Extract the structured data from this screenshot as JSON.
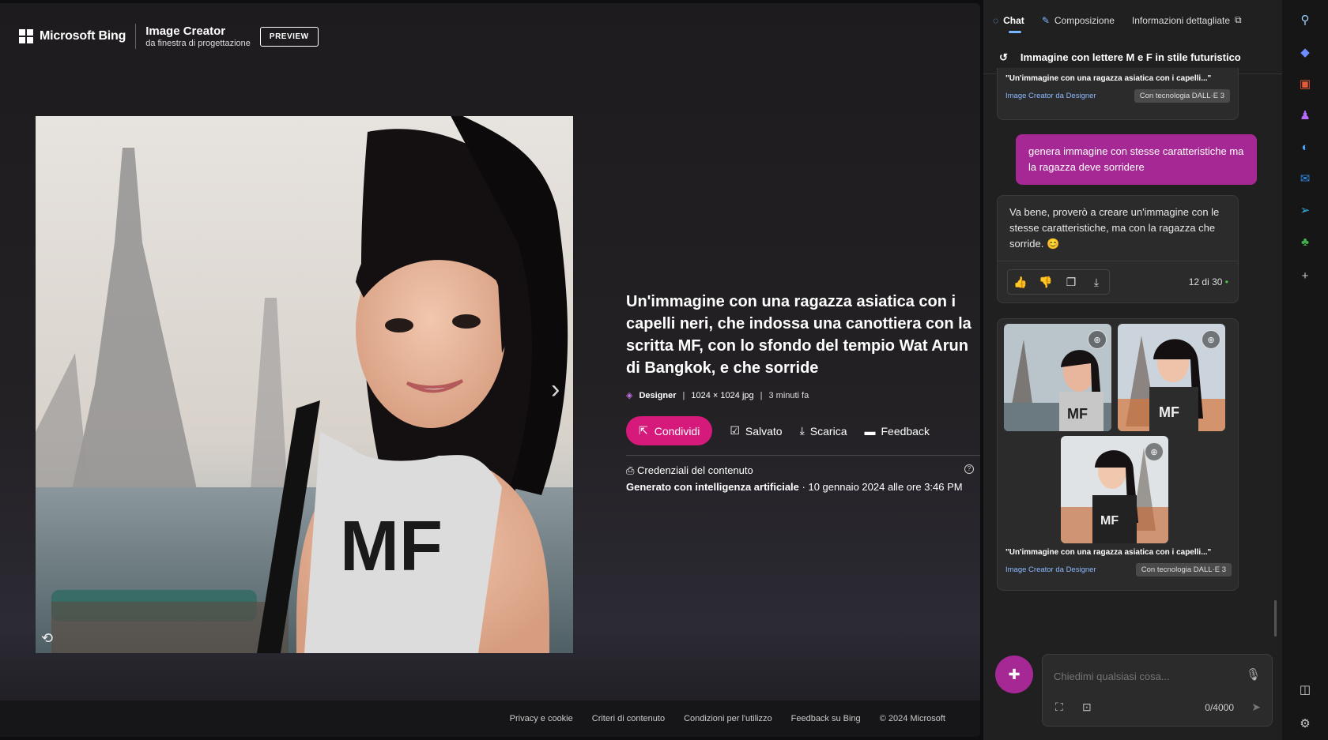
{
  "header": {
    "brand": "Microsoft Bing",
    "app_title": "Image Creator",
    "app_subtitle": "da finestra di progettazione",
    "badge": "PREVIEW"
  },
  "image_info": {
    "title": "Un'immagine con una ragazza asiatica con i capelli neri, che indossa una canottiera con la scritta MF, con lo sfondo del tempio Wat Arun di Bangkok, e che sorride",
    "source": "Designer",
    "dimensions": "1024 × 1024 jpg",
    "time": "3 minuti fa",
    "share_label": "Condividi",
    "saved_label": "Salvato",
    "download_label": "Scarica",
    "feedback_label": "Feedback",
    "credentials_title": "Credenziali del contenuto",
    "credentials_generated": "Generato con intelligenza artificiale",
    "credentials_date": " · 10 gennaio 2024 alle ore 3:46 PM"
  },
  "footer": {
    "links": [
      "Privacy e cookie",
      "Criteri di contenuto",
      "Condizioni per l'utilizzo",
      "Feedback su Bing",
      "© 2024 Microsoft"
    ]
  },
  "sidebar": {
    "tabs": [
      "Chat",
      "Composizione",
      "Informazioni dettagliate"
    ],
    "conversation_title": "Immagine con lettere M e F in stile futuristico",
    "first_card": {
      "caption": "\"Un'immagine con una ragazza asiatica con i capelli...\"",
      "by": "Image Creator da Designer",
      "tech": "Con tecnologia DALL·E 3"
    },
    "user_message": "genera immagine con stesse caratteristiche ma la ragazza deve sorridere",
    "bot_message": "Va bene, proverò a creare un'immagine con le stesse caratteristiche, ma con la ragazza che sorride. 😊",
    "counter": "12 di 30",
    "second_card": {
      "caption": "\"Un'immagine con una ragazza asiatica con i capelli...\"",
      "by": "Image Creator da Designer",
      "tech": "Con tecnologia DALL·E 3"
    },
    "composer_placeholder": "Chiedimi qualsiasi cosa...",
    "char_count": "0/4000"
  },
  "colors": {
    "accent_pink": "#d51a7c",
    "user_bubble": "#a62894",
    "link_blue": "#8ab8ff"
  }
}
